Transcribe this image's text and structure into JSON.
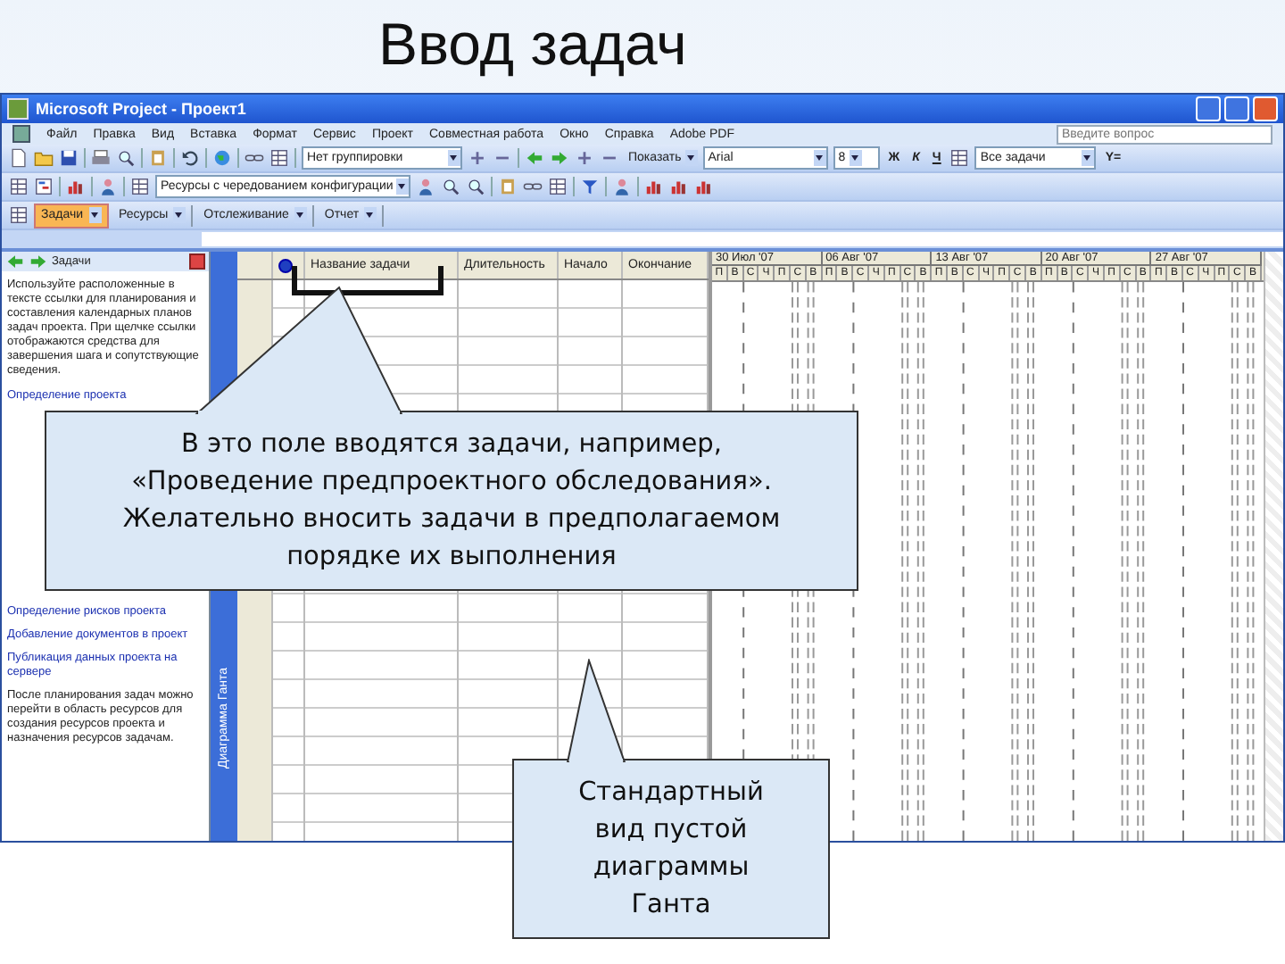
{
  "slide_title": "Ввод задач",
  "window": {
    "title": "Microsoft Project - Проект1"
  },
  "menu": [
    "Файл",
    "Правка",
    "Вид",
    "Вставка",
    "Формат",
    "Сервис",
    "Проект",
    "Совместная работа",
    "Окно",
    "Справка",
    "Adobe PDF"
  ],
  "help_search": {
    "placeholder": "Введите вопрос"
  },
  "standard_toolbar": {
    "grouping": "Нет группировки",
    "show": "Показать",
    "font": "Arial",
    "font_size": "8",
    "bold": "Ж",
    "italic": "К",
    "underline": "Ч",
    "filter": "Все задачи",
    "autofilter": "Y="
  },
  "resource_toolbar": {
    "view": "Ресурсы с чередованием конфигурации"
  },
  "guide_toolbar": [
    {
      "label": "Задачи",
      "selected": true
    },
    {
      "label": "Ресурсы",
      "selected": false
    },
    {
      "label": "Отслеживание",
      "selected": false
    },
    {
      "label": "Отчет",
      "selected": false
    }
  ],
  "side_pane": {
    "title": "Задачи",
    "intro": "Используйте расположенные в тексте ссылки для планирования и составления календарных планов задач проекта. При щелчке ссылки отображаются средства для завершения шага и сопутствующие сведения.",
    "links_top": [
      "Определение проекта"
    ],
    "links_bottom": [
      "Определение рисков проекта",
      "Добавление документов в проект",
      "Публикация данных проекта на сервере"
    ],
    "outro": "После планирования задач можно перейти в область ресурсов для создания ресурсов проекта и назначения ресурсов задачам."
  },
  "view_bar": {
    "label": "Диаграмма Ганта"
  },
  "table": {
    "columns": [
      "Название задачи",
      "Длительность",
      "Начало",
      "Окончание"
    ]
  },
  "timescale": [
    {
      "week": "30 Июл '07",
      "days": [
        "П",
        "В",
        "С",
        "Ч",
        "П",
        "С",
        "В"
      ]
    },
    {
      "week": "06 Авг '07",
      "days": [
        "П",
        "В",
        "С",
        "Ч",
        "П",
        "С",
        "В"
      ]
    },
    {
      "week": "13 Авг '07",
      "days": [
        "П",
        "В",
        "С",
        "Ч",
        "П",
        "С",
        "В"
      ]
    },
    {
      "week": "20 Авг '07",
      "days": [
        "П",
        "В",
        "С",
        "Ч",
        "П",
        "С",
        "В"
      ]
    },
    {
      "week": "27 Авг '07",
      "days": [
        "П",
        "В",
        "С",
        "Ч",
        "П",
        "С",
        "В"
      ]
    }
  ],
  "callouts": [
    {
      "kind": "top",
      "text": "В это поле вводятся задачи, например, «Проведение предпроектного обследования». Желательно вносить задачи в предполагаемом порядке их выполнения"
    },
    {
      "kind": "bottom",
      "text": "Стандартный вид пустой диаграммы Ганта"
    }
  ]
}
